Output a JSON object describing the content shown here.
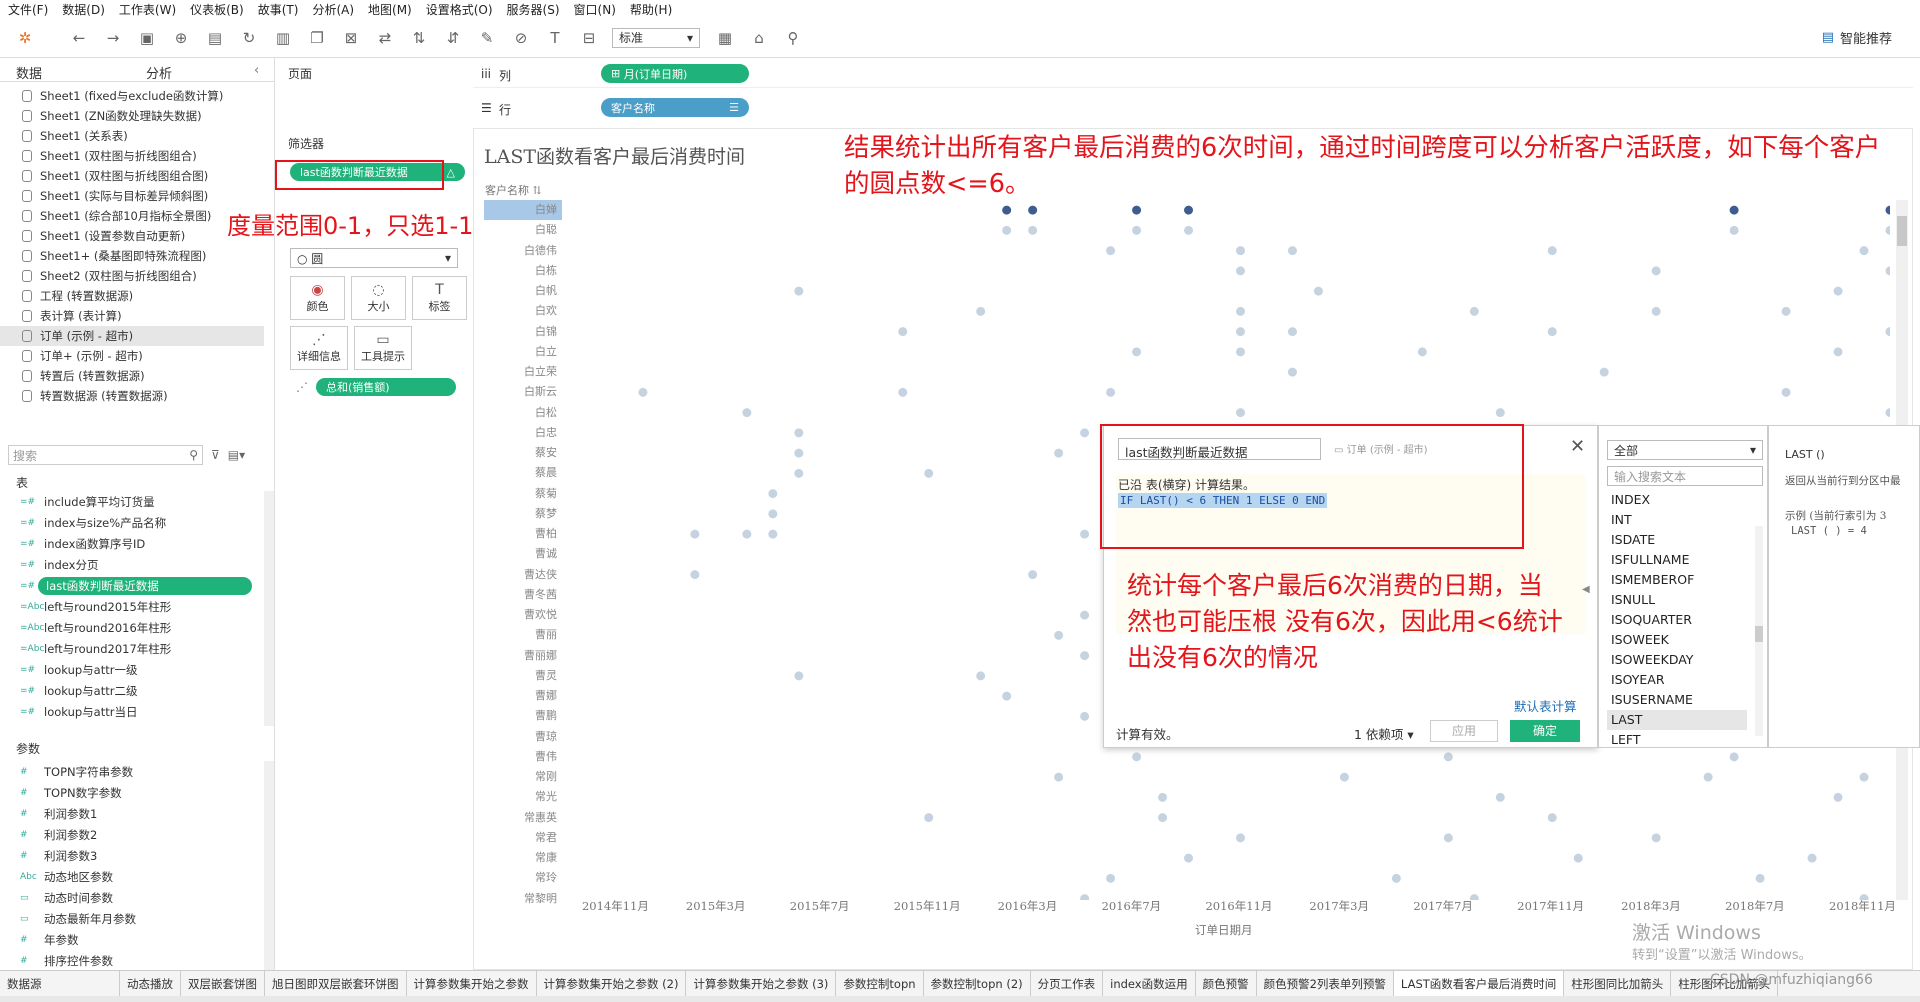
{
  "menu": [
    "文件(F)",
    "数据(D)",
    "工作表(W)",
    "仪表板(B)",
    "故事(T)",
    "分析(A)",
    "地图(M)",
    "设置格式(O)",
    "服务器(S)",
    "窗口(N)",
    "帮助(H)"
  ],
  "toolbar": {
    "standard_select": "标准",
    "smart_recommend": "智能推荐"
  },
  "sidebar": {
    "tabs": [
      "数据",
      "分析"
    ],
    "sources": [
      "Sheet1 (fixed与exclude函数计算)",
      "Sheet1 (ZN函数处理缺失数据)",
      "Sheet1 (关系表)",
      "Sheet1 (双柱图与折线图组合)",
      "Sheet1 (双柱图与折线图组合图)",
      "Sheet1 (实际与目标差异倾斜图)",
      "Sheet1 (综合部10月指标全景图)",
      "Sheet1 (设置参数自动更新)",
      "Sheet1+ (桑基图即特殊流程图)",
      "Sheet2 (双柱图与折线图组合)",
      "工程 (转置数据源)",
      "表计算 (表计算)",
      "订单 (示例 - 超市)",
      "订单+ (示例 - 超市)",
      "转置后 (转置数据源)",
      "转置数据源 (转置数据源)"
    ],
    "search_placeholder": "搜索",
    "table_header": "表",
    "fields": [
      {
        "type": "=#",
        "name": "include算平均订货量"
      },
      {
        "type": "=#",
        "name": "index与size%产品名称"
      },
      {
        "type": "=#",
        "name": "index函数算序号ID"
      },
      {
        "type": "=#",
        "name": "index分页"
      },
      {
        "type": "=#",
        "name": "last函数判断最近数据"
      },
      {
        "type": "=Abc",
        "name": "left与round2015年柱形"
      },
      {
        "type": "=Abc",
        "name": "left与round2016年柱形"
      },
      {
        "type": "=Abc",
        "name": "left与round2017年柱形"
      },
      {
        "type": "=#",
        "name": "lookup与attr一级"
      },
      {
        "type": "=#",
        "name": "lookup与attr二级"
      },
      {
        "type": "=#",
        "name": "lookup与attr当日"
      }
    ],
    "params_header": "参数",
    "params": [
      {
        "type": "#",
        "name": "TOPN字符串参数"
      },
      {
        "type": "#",
        "name": "TOPN数字参数"
      },
      {
        "type": "#",
        "name": "利润参数1"
      },
      {
        "type": "#",
        "name": "利润参数2"
      },
      {
        "type": "#",
        "name": "利润参数3"
      },
      {
        "type": "Abc",
        "name": "动态地区参数"
      },
      {
        "type": "▭",
        "name": "动态时间参数"
      },
      {
        "type": "▭",
        "name": "动态最新年月参数"
      },
      {
        "type": "#",
        "name": "年参数"
      },
      {
        "type": "#",
        "name": "排序控件参数"
      }
    ]
  },
  "cards": {
    "pages": "页面",
    "filters": "筛选器",
    "filter_pill": "last函数判断最近数据",
    "mark_type": "○ 圆",
    "marks": [
      "颜色",
      "大小",
      "标签",
      "详细信息",
      "工具提示"
    ],
    "measure_pill": "总和(销售额)"
  },
  "shelves": {
    "columns_label": "列",
    "columns_pill": "月(订单日期)",
    "rows_label": "行",
    "rows_pill": "客户名称"
  },
  "chart_data": {
    "type": "scatter",
    "title": "LAST函数看客户最后消费时间",
    "row_header": "客户名称",
    "xlabel": "订单日期月",
    "rows": [
      "白婵",
      "白聪",
      "白德伟",
      "白栋",
      "白帆",
      "白欢",
      "白锦",
      "白立",
      "白立荣",
      "白斯云",
      "白松",
      "白忠",
      "蔡安",
      "蔡晨",
      "蔡菊",
      "蔡梦",
      "曹柏",
      "曹诚",
      "曹达侠",
      "曹冬茜",
      "曹欢悦",
      "曹丽",
      "曹丽娜",
      "曹灵",
      "曹娜",
      "曹鹏",
      "曹琼",
      "曹伟",
      "常刚",
      "常光",
      "常惠英",
      "常君",
      "常康",
      "常玲",
      "常黎明"
    ],
    "x_ticks": [
      "2014年11月",
      "2015年3月",
      "2015年7月",
      "2015年11月",
      "2016年3月",
      "2016年7月",
      "2016年11月",
      "2017年3月",
      "2017年7月",
      "2017年11月",
      "2018年3月",
      "2018年7月",
      "2018年11月"
    ],
    "x_range": [
      "2014-09",
      "2018-12"
    ],
    "points": [
      {
        "row": 0,
        "x": [
          "2016-02",
          "2016-03",
          "2016-07",
          "2016-09",
          "2018-06",
          "2018-12"
        ]
      },
      {
        "row": 1,
        "x": [
          "2016-02",
          "2016-03",
          "2016-07",
          "2016-09",
          "2018-06",
          "2018-12"
        ]
      },
      {
        "row": 2,
        "x": [
          "2016-06",
          "2016-11",
          "2017-01",
          "2017-11",
          "2018-11"
        ]
      },
      {
        "row": 3,
        "x": [
          "2016-11",
          "2018-03",
          "2018-12"
        ]
      },
      {
        "row": 4,
        "x": [
          "2015-06",
          "2017-02",
          "2018-10"
        ]
      },
      {
        "row": 5,
        "x": [
          "2016-01",
          "2016-11",
          "2017-08",
          "2018-03",
          "2018-08"
        ]
      },
      {
        "row": 6,
        "x": [
          "2015-10",
          "2016-11",
          "2017-01",
          "2017-11",
          "2018-12"
        ]
      },
      {
        "row": 7,
        "x": [
          "2016-07",
          "2016-11",
          "2017-06",
          "2018-10"
        ]
      },
      {
        "row": 8,
        "x": [
          "2017-01",
          "2018-01"
        ]
      },
      {
        "row": 9,
        "x": [
          "2014-12",
          "2015-10",
          "2016-06",
          "2018-08"
        ]
      },
      {
        "row": 10,
        "x": [
          "2015-04",
          "2016-11",
          "2017-09",
          "2018-12"
        ]
      },
      {
        "row": 11,
        "x": [
          "2015-06",
          "2016-05",
          "2017-08"
        ]
      },
      {
        "row": 12,
        "x": [
          "2015-06",
          "2016-04",
          "2017-03",
          "2018-02",
          "2018-10"
        ]
      },
      {
        "row": 13,
        "x": [
          "2015-06",
          "2015-11",
          "2016-07",
          "2017-01"
        ]
      },
      {
        "row": 14,
        "x": [
          "2015-05",
          "2016-07",
          "2017-09"
        ]
      },
      {
        "row": 15,
        "x": [
          "2015-05",
          "2016-10",
          "2017-12"
        ]
      },
      {
        "row": 16,
        "x": [
          "2015-02",
          "2015-04",
          "2015-05",
          "2016-05",
          "2017-11",
          "2018-09"
        ]
      },
      {
        "row": 17,
        "x": [
          "2016-11",
          "2018-05"
        ]
      },
      {
        "row": 18,
        "x": [
          "2015-02",
          "2016-03",
          "2016-07",
          "2017-05"
        ]
      },
      {
        "row": 19,
        "x": [
          "2016-09",
          "2017-12",
          "2018-09"
        ]
      },
      {
        "row": 20,
        "x": [
          "2016-05",
          "2016-09",
          "2017-11",
          "2018-10"
        ]
      },
      {
        "row": 21,
        "x": [
          "2016-04",
          "2017-02",
          "2018-09"
        ]
      },
      {
        "row": 22,
        "x": [
          "2016-05",
          "2017-10",
          "2018-10"
        ]
      },
      {
        "row": 23,
        "x": [
          "2015-06",
          "2016-01",
          "2016-07",
          "2017-08"
        ]
      },
      {
        "row": 24,
        "x": [
          "2016-02",
          "2016-06",
          "2017-04"
        ]
      },
      {
        "row": 25,
        "x": [
          "2016-05",
          "2017-07",
          "2018-05"
        ]
      },
      {
        "row": 26,
        "x": [
          "2016-09",
          "2017-08",
          "2018-06"
        ]
      },
      {
        "row": 27,
        "x": [
          "2016-07",
          "2017-07",
          "2018-06"
        ]
      },
      {
        "row": 28,
        "x": [
          "2016-04",
          "2017-03",
          "2018-05",
          "2018-11"
        ]
      },
      {
        "row": 29,
        "x": [
          "2016-08",
          "2017-09",
          "2018-10"
        ]
      },
      {
        "row": 30,
        "x": [
          "2015-11",
          "2016-08",
          "2017-11"
        ]
      },
      {
        "row": 31,
        "x": [
          "2016-11",
          "2017-07",
          "2018-03"
        ]
      },
      {
        "row": 32,
        "x": [
          "2016-09",
          "2017-12",
          "2018-09"
        ]
      },
      {
        "row": 33,
        "x": [
          "2016-06",
          "2017-05",
          "2018-07"
        ]
      },
      {
        "row": 34,
        "x": [
          "2016-05",
          "2017-08",
          "2018-11"
        ]
      }
    ],
    "highlight_color": "#3d5d8f",
    "point_color": "#c5d3e0"
  },
  "annotations": {
    "top": "结果统计出所有客户最后消费的6次时间，通过时间跨度可以分析客户活跃度，如下每个客户的圆点数<=6。",
    "filter_note": "度量范围0-1，只选1-1",
    "calc_note": "统计每个客户最后6次消费的日期，当然也可能压根 没有6次，因此用<6统计出没有6次的情况"
  },
  "calc_dialog": {
    "name": "last函数判断最近数据",
    "source": "订单 (示例 - 超市)",
    "line1": "已沿 表(横穿) 计算结果。",
    "formula": "IF LAST() < 6 THEN 1 ELSE 0 END",
    "default_table_calc": "默认表计算",
    "status": "计算有效。",
    "dependencies": "1 依赖项 ▾",
    "apply": "应用",
    "ok": "确定",
    "category_select": "全部",
    "fn_search_placeholder": "输入搜索文本",
    "functions": [
      "INDEX",
      "INT",
      "ISDATE",
      "ISFULLNAME",
      "ISMEMBEROF",
      "ISNULL",
      "ISOQUARTER",
      "ISOWEEK",
      "ISOWEEKDAY",
      "ISOYEAR",
      "ISUSERNAME",
      "LAST",
      "LEFT"
    ],
    "help_title": "LAST ()",
    "help_desc": "返回从当前行到分区中最",
    "help_example": "示例 (当前行索引为 3",
    "help_code": "LAST ( ) = 4"
  },
  "bottom_tabs": [
    "数据源",
    "动态播放",
    "双层嵌套饼图",
    "旭日图即双层嵌套环饼图",
    "计算参数集开始之参数",
    "计算参数集开始之参数 (2)",
    "计算参数集开始之参数 (3)",
    "参数控制topn",
    "参数控制topn (2)",
    "分页工作表",
    "index函数运用",
    "颜色预警",
    "颜色预警2列表单列预警",
    "LAST函数看客户最后消费时间",
    "柱形图同比加箭头",
    "柱形图环比加箭头"
  ],
  "watermark": {
    "line1": "激活 Windows",
    "line2": "转到“设置”以激活 Windows。",
    "csdn": "CSDN @mfuzhiqiang66"
  }
}
